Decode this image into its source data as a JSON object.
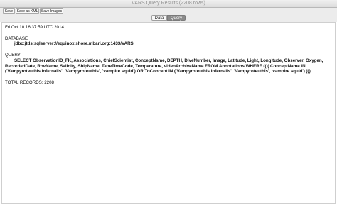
{
  "window": {
    "title": "VARS Query Results (2208 rows)"
  },
  "toolbar": {
    "save_label": "Save",
    "save_xml_label": "Save as KML",
    "save_images_label": "Save Images"
  },
  "tabs": [
    {
      "label": "Data",
      "active": false
    },
    {
      "label": "Query",
      "active": true
    }
  ],
  "query_panel": {
    "timestamp": "Fri Oct 10 16:37:59 UTC 2014",
    "database_heading": "DATABASE",
    "database_url": "jdbc:jtds:sqlserver://equinox.shore.mbari.org:1433/VARS",
    "query_heading": "QUERY",
    "query_text": "SELECT ObservationID_FK, Associations, ChiefScientist, ConceptName, DEPTH, DiveNumber, Image, Latitude, Light, Longitude, Observer, Oxygen, RecordedDate, RovName, Salinity, ShipName, TapeTimeCode, Temperature, videoArchiveName FROM Annotations WHERE (( ( ConceptName IN ('Vampyroteuthis infernalis', 'Vampyroteuthis', 'vampire squid') OR ToConcept IN ('Vampyroteuthis infernalis', 'Vampyroteuthis', 'vampire squid') )))",
    "total_records": "TOTAL RECORDS: 2208"
  }
}
